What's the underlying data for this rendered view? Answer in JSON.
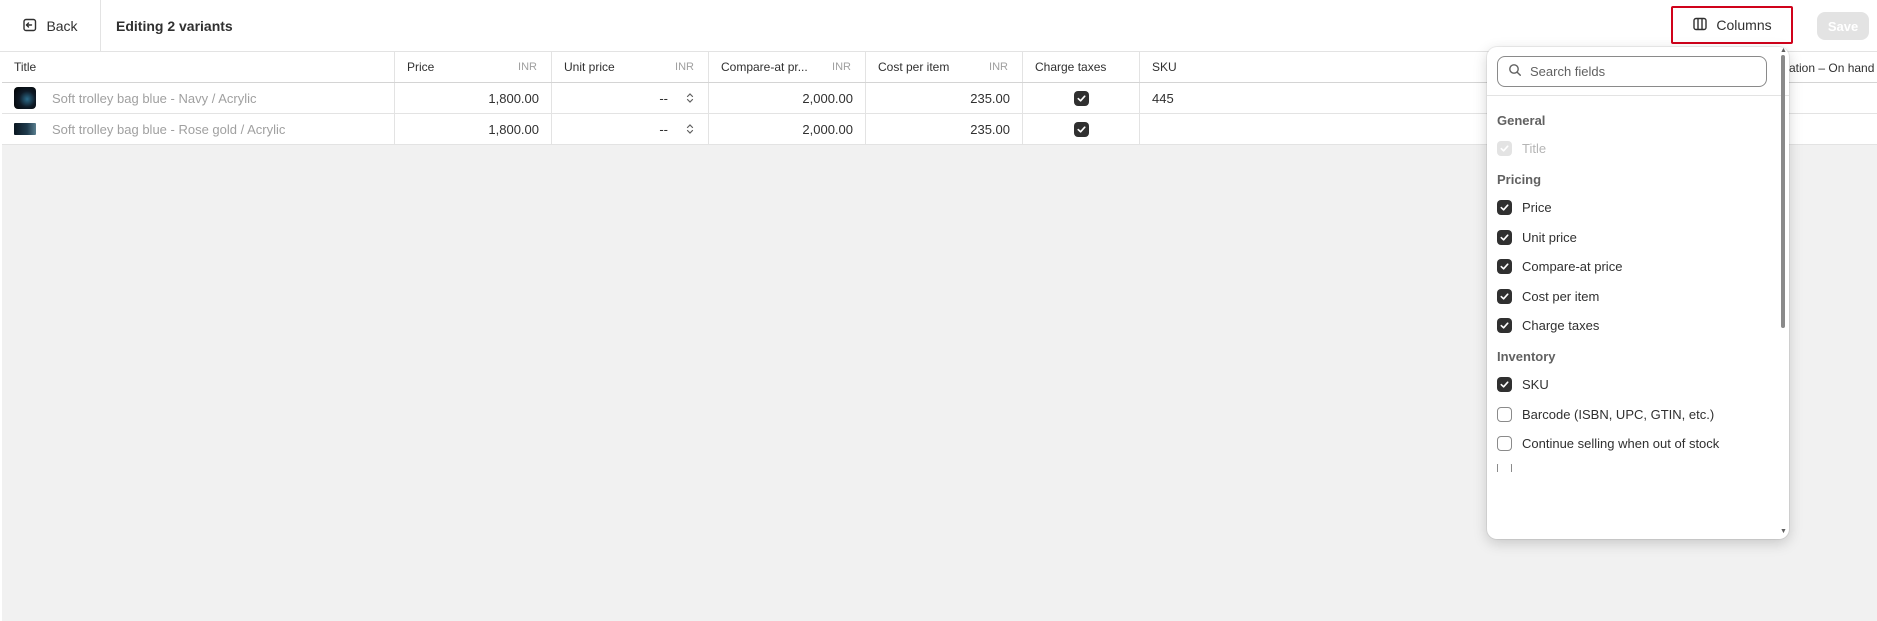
{
  "topbar": {
    "back_label": "Back",
    "title": "Editing 2 variants",
    "columns_label": "Columns",
    "save_label": "Save"
  },
  "table": {
    "headers": {
      "title": "Title",
      "price": "Price",
      "price_unit": "INR",
      "unit_price": "Unit price",
      "unit_price_unit": "INR",
      "compare": "Compare-at pr...",
      "compare_unit": "INR",
      "cost": "Cost per item",
      "cost_unit": "INR",
      "taxes": "Charge taxes",
      "sku": "SKU",
      "location_partial": "cation – On hand"
    },
    "rows": [
      {
        "title": "Soft trolley bag blue - Navy / Acrylic",
        "price": "1,800.00",
        "unit_price": "--",
        "compare": "2,000.00",
        "cost": "235.00",
        "charge_taxes": true,
        "sku": "445"
      },
      {
        "title": "Soft trolley bag blue - Rose gold / Acrylic",
        "price": "1,800.00",
        "unit_price": "--",
        "compare": "2,000.00",
        "cost": "235.00",
        "charge_taxes": true,
        "sku": ""
      }
    ]
  },
  "columns_popover": {
    "search_placeholder": "Search fields",
    "groups": [
      {
        "label": "General"
      },
      {
        "label": "Pricing"
      },
      {
        "label": "Inventory"
      }
    ],
    "options": [
      {
        "label": "Title",
        "checked": true,
        "disabled": true
      },
      {
        "label": "Price",
        "checked": true
      },
      {
        "label": "Unit price",
        "checked": true
      },
      {
        "label": "Compare-at price",
        "checked": true
      },
      {
        "label": "Cost per item",
        "checked": true
      },
      {
        "label": "Charge taxes",
        "checked": true
      },
      {
        "label": "SKU",
        "checked": true
      },
      {
        "label": "Barcode (ISBN, UPC, GTIN, etc.)",
        "checked": false
      },
      {
        "label": "Continue selling when out of stock",
        "checked": false
      }
    ]
  },
  "colors": {
    "highlight_border": "#d0021b",
    "checkbox_fill": "#303030",
    "grid_background": "#f1f1f1"
  }
}
